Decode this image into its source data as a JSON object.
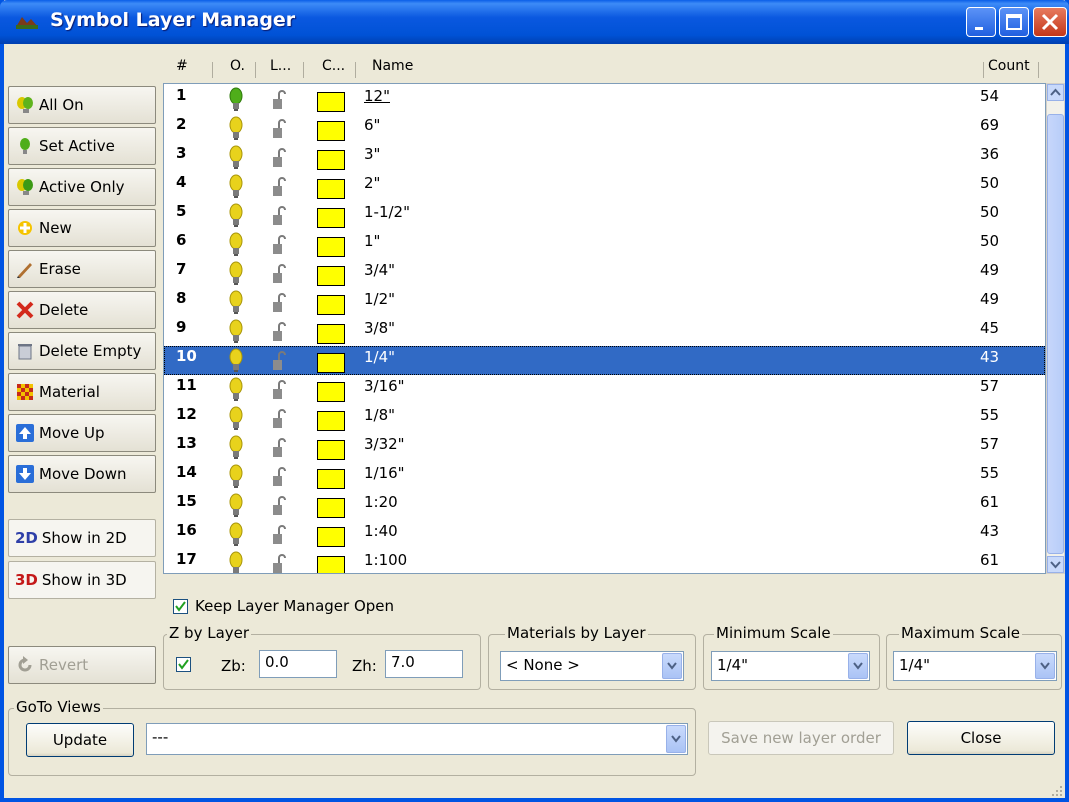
{
  "window": {
    "title": "Symbol Layer Manager"
  },
  "columns": {
    "num": "#",
    "on": "O.",
    "lock": "L...",
    "color": "C...",
    "name": "Name",
    "count": "Count"
  },
  "sidebar": {
    "all_on": "All On",
    "set_active": "Set Active",
    "active_only": "Active Only",
    "new": "New",
    "erase": "Erase",
    "delete": "Delete",
    "delete_empty": "Delete Empty",
    "material": "Material",
    "move_up": "Move Up",
    "move_down": "Move Down",
    "show_2d_prefix": "2D",
    "show_2d": "Show in 2D",
    "show_3d_prefix": "3D",
    "show_3d": "Show in 3D",
    "revert": "Revert"
  },
  "layers": [
    {
      "num": "1",
      "name": "12\"",
      "count": "54"
    },
    {
      "num": "2",
      "name": "6\"",
      "count": "69"
    },
    {
      "num": "3",
      "name": "3\"",
      "count": "36"
    },
    {
      "num": "4",
      "name": "2\"",
      "count": "50"
    },
    {
      "num": "5",
      "name": "1-1/2\"",
      "count": "50"
    },
    {
      "num": "6",
      "name": "1\"",
      "count": "50"
    },
    {
      "num": "7",
      "name": "3/4\"",
      "count": "49"
    },
    {
      "num": "8",
      "name": "1/2\"",
      "count": "49"
    },
    {
      "num": "9",
      "name": "3/8\"",
      "count": "45"
    },
    {
      "num": "10",
      "name": "1/4\"",
      "count": "43"
    },
    {
      "num": "11",
      "name": "3/16\"",
      "count": "57"
    },
    {
      "num": "12",
      "name": "1/8\"",
      "count": "55"
    },
    {
      "num": "13",
      "name": "3/32\"",
      "count": "57"
    },
    {
      "num": "14",
      "name": "1/16\"",
      "count": "55"
    },
    {
      "num": "15",
      "name": "1:20",
      "count": "61"
    },
    {
      "num": "16",
      "name": "1:40",
      "count": "43"
    },
    {
      "num": "17",
      "name": "1:100",
      "count": "61"
    }
  ],
  "selected_layer": "10",
  "keep_open": {
    "label": "Keep Layer Manager Open",
    "checked": true
  },
  "z_by_layer": {
    "label": "Z by Layer",
    "checked": true,
    "zb_label": "Zb:",
    "zb": "0.0",
    "zh_label": "Zh:",
    "zh": "7.0"
  },
  "materials": {
    "label": "Materials by Layer",
    "value": "< None >"
  },
  "min_scale": {
    "label": "Minimum Scale",
    "value": "1/4\""
  },
  "max_scale": {
    "label": "Maximum Scale",
    "value": "1/4\""
  },
  "goto_views": {
    "label": "GoTo Views",
    "update": "Update",
    "value": "---"
  },
  "buttons": {
    "save_order": "Save new layer order",
    "close": "Close"
  },
  "colors": {
    "layer_swatch": "#ffff00",
    "selection": "#316ac5"
  }
}
